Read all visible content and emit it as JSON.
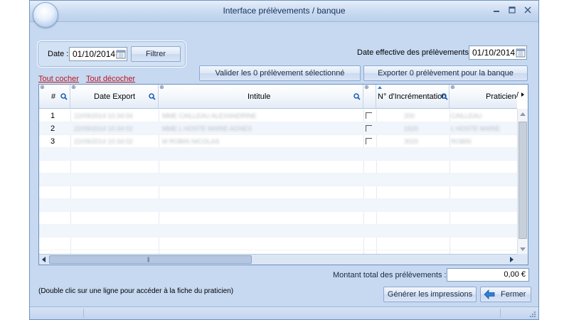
{
  "window": {
    "title": "Interface prélèvements / banque"
  },
  "filter": {
    "date_label": "Date :",
    "date_value": "01/10/2014",
    "filter_button": "Filtrer"
  },
  "effective": {
    "label": "Date effective des prélèvements :",
    "date_value": "01/10/2014"
  },
  "links": {
    "check_all": "Tout cocher",
    "uncheck_all": "Tout décocher"
  },
  "actions": {
    "validate": "Valider les 0 prélèvement sélectionné",
    "export": "Exporter 0 prélèvement pour la banque"
  },
  "grid": {
    "columns": [
      "#",
      "Date Export",
      "Intitule",
      "",
      "N° d'Incrémentation",
      "Praticien"
    ],
    "rows": [
      {
        "num": "1",
        "date_export": "22/09/2014 10:34:04",
        "intitule": "MME CAILLEAU ALEXANDRINE",
        "increment": "200",
        "praticien": "CAILLEAU"
      },
      {
        "num": "2",
        "date_export": "22/09/2014 10:34:02",
        "intitule": "MME L HOSTE MARIE AGNES",
        "increment": "1620",
        "praticien": "L HOSTE MARIE"
      },
      {
        "num": "3",
        "date_export": "22/09/2014 10:34:02",
        "intitule": "M ROBIN NICOLAS",
        "increment": "3020",
        "praticien": "ROBIN"
      }
    ]
  },
  "total": {
    "label": "Montant total des prélèvements :",
    "value": "0,00 €"
  },
  "hint": "(Double clic sur une ligne pour accéder à la fiche du praticien)",
  "buttons": {
    "print": "Générer les impressions",
    "close": "Fermer"
  },
  "colors": {
    "window_bg": "#c6d9f1",
    "link": "#c0141b"
  }
}
